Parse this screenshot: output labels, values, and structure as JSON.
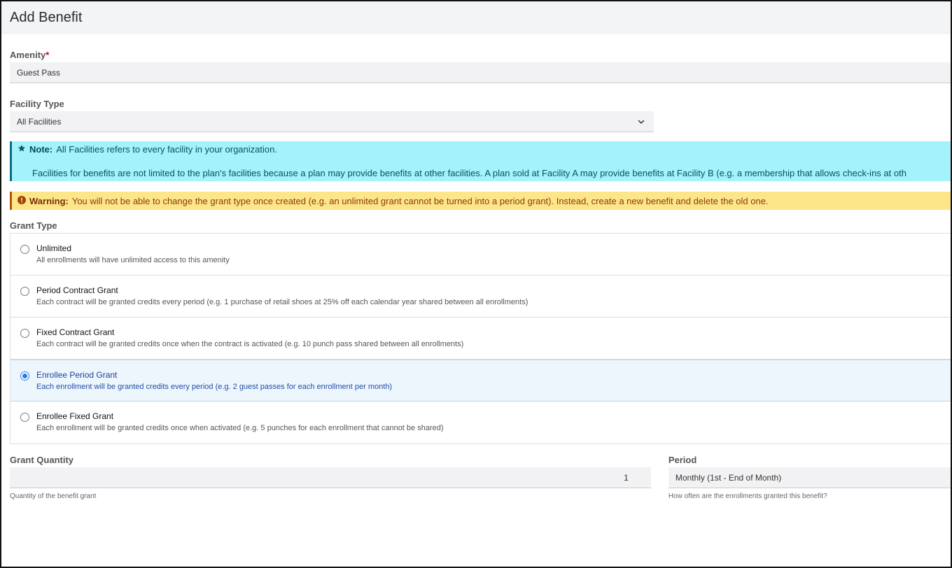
{
  "header": {
    "title": "Add Benefit"
  },
  "amenity": {
    "label": "Amenity",
    "required_mark": "*",
    "value": "Guest Pass"
  },
  "facility": {
    "label": "Facility Type",
    "value": "All Facilities"
  },
  "note": {
    "prefix": "Note:",
    "line1": "All Facilities refers to every facility in your organization.",
    "line2": "Facilities for benefits are not limited to the plan's facilities because a plan may provide benefits at other facilities. A plan sold at Facility A may provide benefits at Facility B (e.g. a membership that allows check-ins at oth"
  },
  "warning": {
    "prefix": "Warning:",
    "text": "You will not be able to change the grant type once created (e.g. an unlimited grant cannot be turned into a period grant). Instead, create a new benefit and delete the old one."
  },
  "grant_type": {
    "label": "Grant Type",
    "selected_index": 3,
    "options": [
      {
        "title": "Unlimited",
        "desc": "All enrollments will have unlimited access to this amenity"
      },
      {
        "title": "Period Contract Grant",
        "desc": "Each contract will be granted credits every period (e.g. 1 purchase of retail shoes at 25% off each calendar year shared between all enrollments)"
      },
      {
        "title": "Fixed Contract Grant",
        "desc": "Each contract will be granted credits once when the contract is activated (e.g. 10 punch pass shared between all enrollments)"
      },
      {
        "title": "Enrollee Period Grant",
        "desc": "Each enrollment will be granted credits every period (e.g. 2 guest passes for each enrollment per month)"
      },
      {
        "title": "Enrollee Fixed Grant",
        "desc": "Each enrollment will be granted credits once when activated (e.g. 5 punches for each enrollment that cannot be shared)"
      }
    ]
  },
  "grant_quantity": {
    "label": "Grant Quantity",
    "value": "1",
    "help": "Quantity of the benefit grant"
  },
  "period": {
    "label": "Period",
    "value": "Monthly (1st - End of Month)",
    "help": "How often are the enrollments granted this benefit?"
  },
  "colors": {
    "note_bg": "#a4f2fa",
    "warning_bg": "#fde68a",
    "accent": "#2a7be4"
  }
}
